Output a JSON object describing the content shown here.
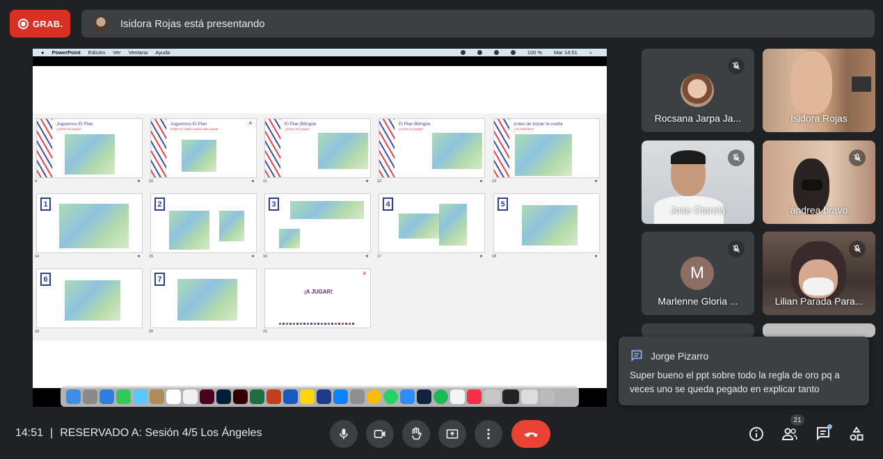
{
  "recording": {
    "label": "GRAB."
  },
  "presenting": {
    "text": "Isidora Rojas está presentando"
  },
  "mac_menu": {
    "app": "PowerPoint",
    "items": [
      "Edición",
      "Ver",
      "Ventana",
      "Ayuda"
    ],
    "battery": "100 %",
    "clock": "Mar 14:51"
  },
  "slides": [
    {
      "n": "9",
      "title": "Juguemos El Plan",
      "sub": "¿Cómo se juega?"
    },
    {
      "n": "10",
      "title": "Juguemos El Plan",
      "sub": "Orden en tablero para cada ayuda"
    },
    {
      "n": "11",
      "title": "El Plan Bilingüe",
      "sub": "¿Cómo se juega?"
    },
    {
      "n": "12",
      "title": "El Plan Bilingüe",
      "sub": "¿Cómo se juega?"
    },
    {
      "n": "13",
      "title": "Antes de iniciar la vuelta",
      "sub": "¿Ya está listo?"
    },
    {
      "n": "14",
      "badge": "1"
    },
    {
      "n": "15",
      "badge": "2"
    },
    {
      "n": "16",
      "badge": "3"
    },
    {
      "n": "17",
      "badge": "4"
    },
    {
      "n": "18",
      "badge": "5"
    },
    {
      "n": "19",
      "badge": "6"
    },
    {
      "n": "20",
      "badge": "7"
    },
    {
      "n": "21",
      "title_center": "¡A JUGAR!"
    }
  ],
  "participants": [
    {
      "name": "Rocsana Jarpa Ja...",
      "muted": true
    },
    {
      "name": "Isidora Rojas",
      "muted": false
    },
    {
      "name": "Jose Otarola",
      "muted": true
    },
    {
      "name": "andrea bravo",
      "muted": true
    },
    {
      "name": "Marlenne Gloria ...",
      "initial": "M",
      "muted": true
    },
    {
      "name": "Lilian Parada Para...",
      "muted": true
    }
  ],
  "chat_toast": {
    "sender": "Jorge Pizarro",
    "message": "Super bueno el ppt sobre todo la regla de oro pq a veces uno se queda pegado en explicar tanto"
  },
  "meeting": {
    "time": "14:51",
    "separator": "|",
    "name": "RESERVADO A: Sesión 4/5 Los Ángeles"
  },
  "people_count": "21",
  "colors": {
    "hangup": "#ea4335",
    "record": "#d93025",
    "panel": "#3c4043",
    "bg": "#202124"
  }
}
